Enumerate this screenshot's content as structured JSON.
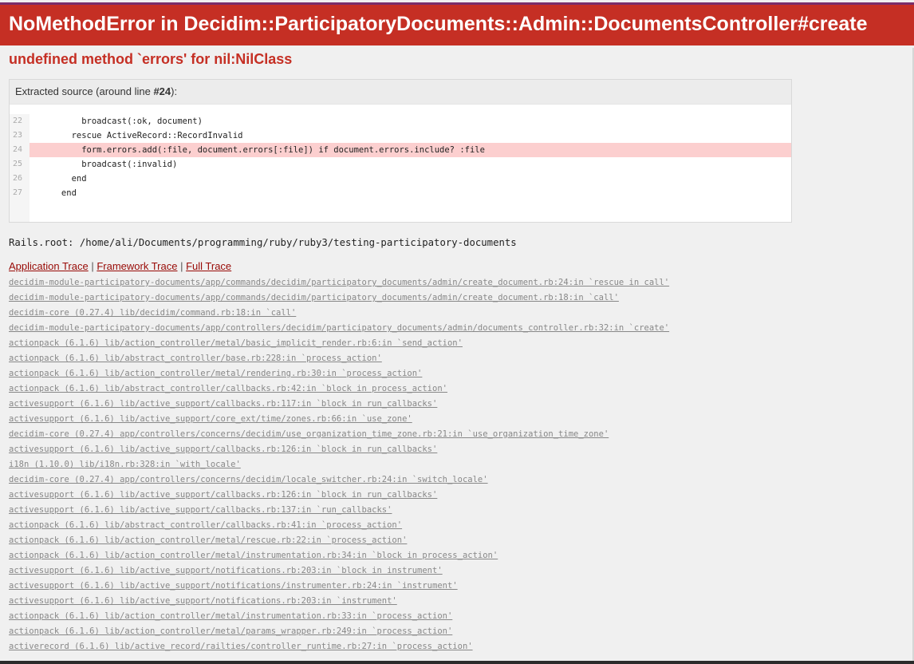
{
  "header": {
    "title": "NoMethodError in Decidim::ParticipatoryDocuments::Admin::DocumentsController#create"
  },
  "exception_message": "undefined method `errors' for nil:NilClass",
  "source": {
    "info_prefix": "Extracted source (around line ",
    "info_line": "#24",
    "info_suffix": "):",
    "lines": [
      {
        "number": "22",
        "code": "          broadcast(:ok, document)",
        "highlight": false
      },
      {
        "number": "23",
        "code": "        rescue ActiveRecord::RecordInvalid",
        "highlight": false
      },
      {
        "number": "24",
        "code": "          form.errors.add(:file, document.errors[:file]) if document.errors.include? :file",
        "highlight": true
      },
      {
        "number": "25",
        "code": "          broadcast(:invalid)",
        "highlight": false
      },
      {
        "number": "26",
        "code": "        end",
        "highlight": false
      },
      {
        "number": "27",
        "code": "      end",
        "highlight": false
      }
    ]
  },
  "rails_root": "Rails.root: /home/ali/Documents/programming/ruby/ruby3/testing-participatory-documents",
  "trace_tabs": {
    "application": "Application Trace",
    "framework": "Framework Trace",
    "full": "Full Trace",
    "separator": " | "
  },
  "trace": [
    "decidim-module-participatory-documents/app/commands/decidim/participatory_documents/admin/create_document.rb:24:in `rescue in call'",
    "decidim-module-participatory-documents/app/commands/decidim/participatory_documents/admin/create_document.rb:18:in `call'",
    "decidim-core (0.27.4) lib/decidim/command.rb:18:in `call'",
    "decidim-module-participatory-documents/app/controllers/decidim/participatory_documents/admin/documents_controller.rb:32:in `create'",
    "actionpack (6.1.6) lib/action_controller/metal/basic_implicit_render.rb:6:in `send_action'",
    "actionpack (6.1.6) lib/abstract_controller/base.rb:228:in `process_action'",
    "actionpack (6.1.6) lib/action_controller/metal/rendering.rb:30:in `process_action'",
    "actionpack (6.1.6) lib/abstract_controller/callbacks.rb:42:in `block in process_action'",
    "activesupport (6.1.6) lib/active_support/callbacks.rb:117:in `block in run_callbacks'",
    "activesupport (6.1.6) lib/active_support/core_ext/time/zones.rb:66:in `use_zone'",
    "decidim-core (0.27.4) app/controllers/concerns/decidim/use_organization_time_zone.rb:21:in `use_organization_time_zone'",
    "activesupport (6.1.6) lib/active_support/callbacks.rb:126:in `block in run_callbacks'",
    "i18n (1.10.0) lib/i18n.rb:328:in `with_locale'",
    "decidim-core (0.27.4) app/controllers/concerns/decidim/locale_switcher.rb:24:in `switch_locale'",
    "activesupport (6.1.6) lib/active_support/callbacks.rb:126:in `block in run_callbacks'",
    "activesupport (6.1.6) lib/active_support/callbacks.rb:137:in `run_callbacks'",
    "actionpack (6.1.6) lib/abstract_controller/callbacks.rb:41:in `process_action'",
    "actionpack (6.1.6) lib/action_controller/metal/rescue.rb:22:in `process_action'",
    "actionpack (6.1.6) lib/action_controller/metal/instrumentation.rb:34:in `block in process_action'",
    "activesupport (6.1.6) lib/active_support/notifications.rb:203:in `block in instrument'",
    "activesupport (6.1.6) lib/active_support/notifications/instrumenter.rb:24:in `instrument'",
    "activesupport (6.1.6) lib/active_support/notifications.rb:203:in `instrument'",
    "actionpack (6.1.6) lib/action_controller/metal/instrumentation.rb:33:in `process_action'",
    "actionpack (6.1.6) lib/action_controller/metal/params_wrapper.rb:249:in `process_action'",
    "activerecord (6.1.6) lib/active_record/railties/controller_runtime.rb:27:in `process_action'"
  ]
}
